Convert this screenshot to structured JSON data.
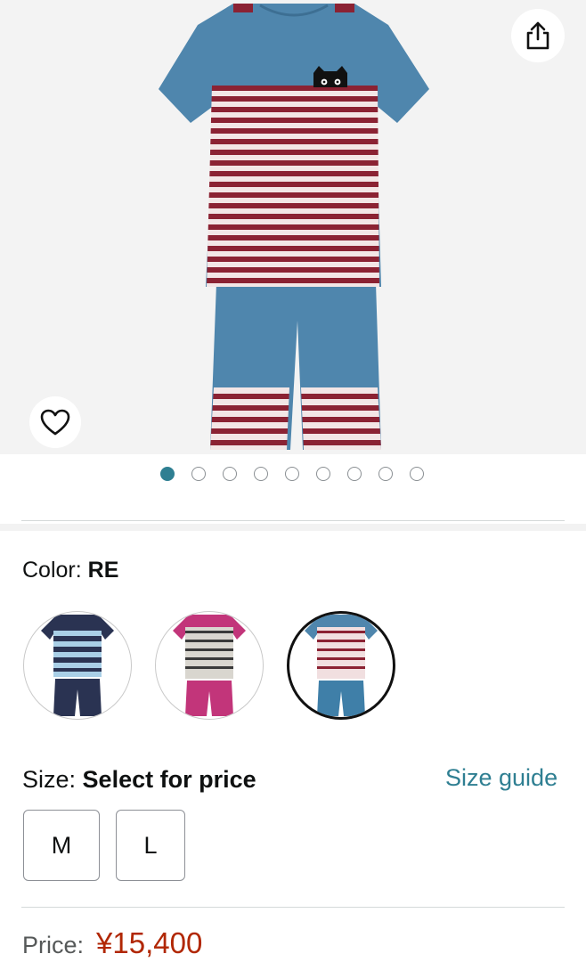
{
  "product_image": {
    "carousel_total": 9,
    "carousel_active_index": 0
  },
  "icons": {
    "share": "share-icon",
    "favorite": "heart-icon"
  },
  "color": {
    "label": "Color:",
    "selected": "RE",
    "swatches": [
      {
        "name": "navy-blue",
        "top_color": "#a9cfe6",
        "bottom_color": "#2a3352"
      },
      {
        "name": "pink-grey",
        "top_color": "#d9d6cf",
        "bottom_color": "#c2357a"
      },
      {
        "name": "red-blue",
        "top_color": "#f1dfe0",
        "bottom_color": "#3f7fa8",
        "selected": true
      }
    ]
  },
  "size": {
    "label": "Size:",
    "value": "Select for price",
    "guide_link": "Size guide",
    "options": [
      "M",
      "L"
    ]
  },
  "price": {
    "label": "Price:",
    "amount": "¥15,400"
  },
  "colors": {
    "accent": "#2f7f92",
    "price": "#b12704",
    "shirt_blue": "#4f86ad",
    "stripe_red": "#8b2233"
  }
}
